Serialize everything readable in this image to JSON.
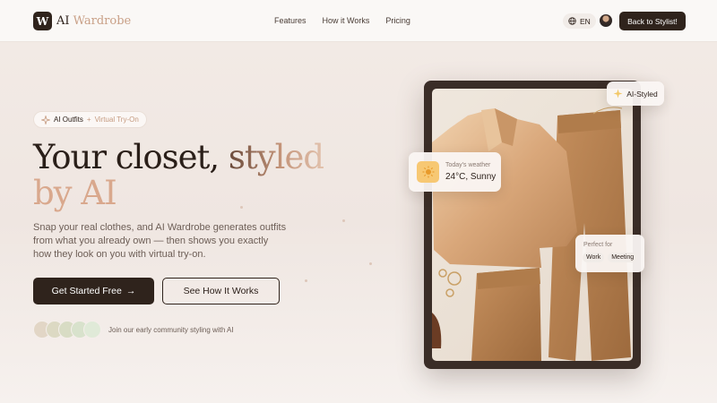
{
  "brand": {
    "logo_mark": "W",
    "name_part1": "AI",
    "name_part2": " Wardrobe"
  },
  "nav": {
    "links": [
      "Features",
      "How it Works",
      "Pricing"
    ],
    "lang_label": "EN",
    "back_label": "Back to Stylist!"
  },
  "hero": {
    "badge_part1": "AI Outfits",
    "badge_sep": "+",
    "badge_part2": "Virtual Try-On",
    "headline_line1_a": "Your closet, ",
    "headline_line1_b": "styled",
    "headline_line2": "by AI",
    "description": "Snap your real clothes, and AI Wardrobe generates outfits from what you already own — then shows you exactly how they look on you with virtual try-on.",
    "primary_cta": "Get Started Free",
    "primary_cta_arrow": "→",
    "secondary_cta": "See How It Works",
    "community_text": "Join our early community styling with AI"
  },
  "preview": {
    "styled_label": "AI-Styled",
    "weather_label": "Today's weather",
    "weather_value": "24°C, Sunny",
    "occasion_label": "Perfect for",
    "occasion_chips": [
      "Work",
      "Meeting"
    ]
  },
  "icons": {
    "badge": "sparkle-icon",
    "lang": "globe-icon",
    "weather": "sun-icon",
    "styled": "sparkle-icon",
    "cta": "arrow-right-icon"
  },
  "colors": {
    "primary": "#2f231c",
    "accent": "#c9a087",
    "background": "#f3ebe6",
    "sun": "#f7c873",
    "community_circles": [
      "#e2d6c6",
      "#dcd9c3",
      "#d8dcc4",
      "#d8e2cc",
      "#e0ead8"
    ]
  }
}
